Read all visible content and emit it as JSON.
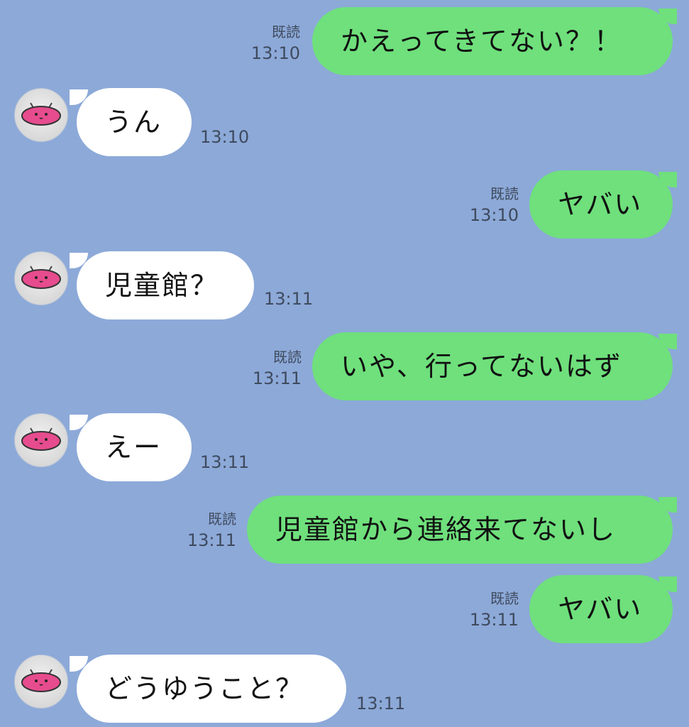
{
  "read_label": "既読",
  "contact": {
    "avatar_icon": "pink-rabbit-icon"
  },
  "messages": [
    {
      "side": "out",
      "text": "かえってきてない？！",
      "time": "13:10",
      "read": true
    },
    {
      "side": "in",
      "text": "うん",
      "time": "13:10"
    },
    {
      "side": "out",
      "text": "ヤバい",
      "time": "13:10",
      "read": true
    },
    {
      "side": "in",
      "text": "児童館？",
      "time": "13:11"
    },
    {
      "side": "out",
      "text": "いや、行ってないはず",
      "time": "13:11",
      "read": true
    },
    {
      "side": "in",
      "text": "えー",
      "time": "13:11"
    },
    {
      "side": "out",
      "text": "児童館から連絡来てないし",
      "time": "13:11",
      "read": true
    },
    {
      "side": "out",
      "text": "ヤバい",
      "time": "13:11",
      "read": true
    },
    {
      "side": "in",
      "text": "どうゆうこと？",
      "time": "13:11"
    }
  ],
  "colors": {
    "background": "#8ca9d8",
    "outgoing": "#6fe07c",
    "incoming": "#ffffff"
  }
}
